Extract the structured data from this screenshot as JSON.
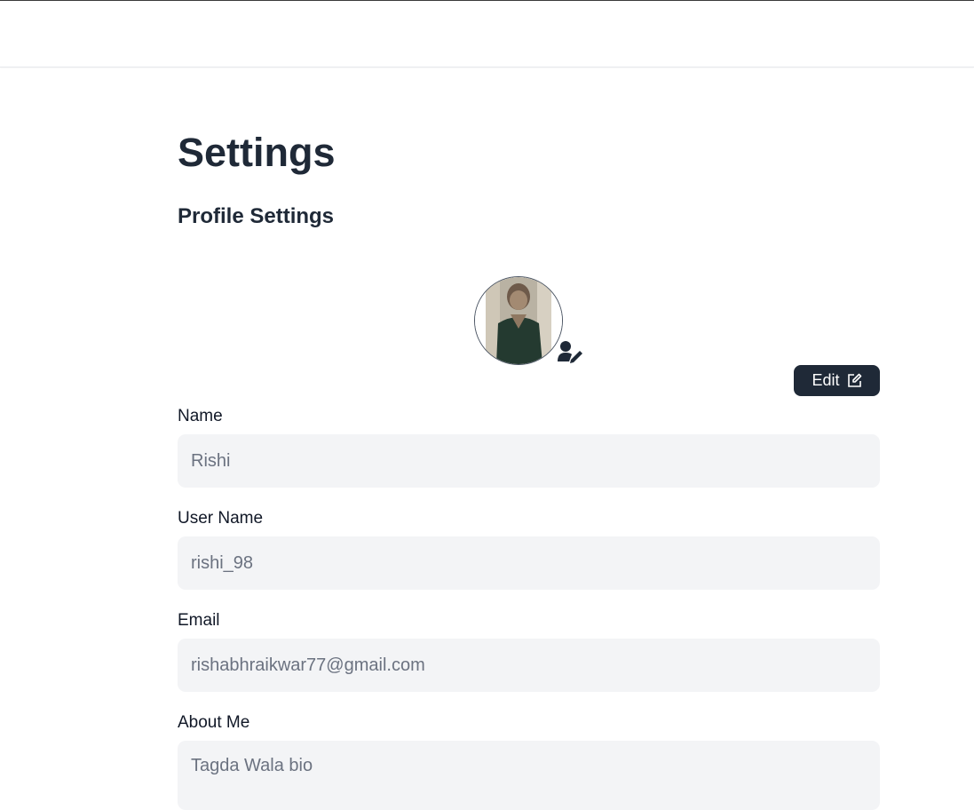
{
  "page": {
    "title": "Settings",
    "section_title": "Profile Settings"
  },
  "profile": {
    "avatar_alt": "profile photo",
    "edit_button_label": "Edit"
  },
  "fields": {
    "name": {
      "label": "Name",
      "value": "Rishi"
    },
    "username": {
      "label": "User Name",
      "value": "rishi_98"
    },
    "email": {
      "label": "Email",
      "value": "rishabhraikwar77@gmail.com"
    },
    "about": {
      "label": "About Me",
      "value": "Tagda Wala bio"
    }
  },
  "icons": {
    "avatar_edit": "user-edit-icon",
    "edit_button": "pencil-square-icon"
  },
  "colors": {
    "primary_dark": "#1f2937",
    "input_bg": "#f3f4f6",
    "input_text": "#6b7280"
  }
}
